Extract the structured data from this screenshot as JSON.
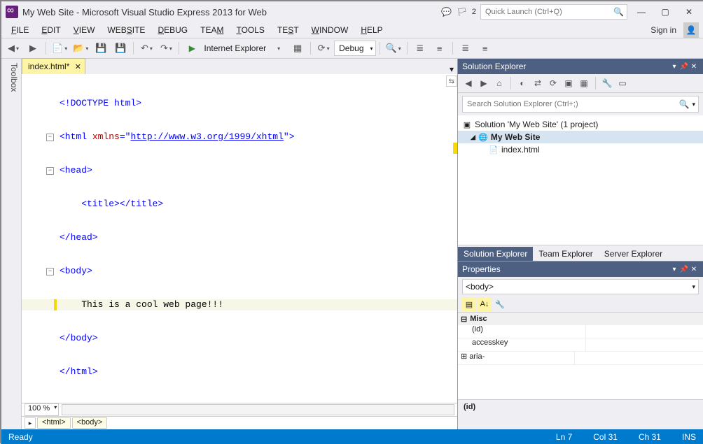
{
  "title": "My Web Site - Microsoft Visual Studio Express 2013 for Web",
  "notif_count": "2",
  "quicklaunch_placeholder": "Quick Launch (Ctrl+Q)",
  "menu": [
    "FILE",
    "EDIT",
    "VIEW",
    "WEBSITE",
    "DEBUG",
    "TEAM",
    "TOOLS",
    "TEST",
    "WINDOW",
    "HELP"
  ],
  "signin": "Sign in",
  "toolbar": {
    "run_target": "Internet Explorer",
    "config": "Debug"
  },
  "toolbox_label": "Toolbox",
  "tab": {
    "name": "index.html*"
  },
  "code": {
    "l1": "<!DOCTYPE html>",
    "l2a": "<html ",
    "l2b": "xmlns",
    "l2c": "=",
    "l2d": "\"",
    "l2e": "http://www.w3.org/1999/xhtml",
    "l2f": "\">",
    "l3": "<head>",
    "l4": "    <title></title>",
    "l5": "</head>",
    "l6": "<body>",
    "l7": "    This is a cool web page!!!",
    "l8": "</body>",
    "l9": "</html>"
  },
  "zoom": "100 %",
  "breadcrumb": [
    "<html>",
    "<body>"
  ],
  "se": {
    "title": "Solution Explorer",
    "search_placeholder": "Search Solution Explorer (Ctrl+;)",
    "sol": "Solution 'My Web Site' (1 project)",
    "proj": "My Web Site",
    "file": "index.html",
    "tabs": [
      "Solution Explorer",
      "Team Explorer",
      "Server Explorer"
    ]
  },
  "props": {
    "title": "Properties",
    "selector": "<body>",
    "cat": "Misc",
    "rows": [
      {
        "name": "(id)",
        "val": ""
      },
      {
        "name": "accesskey",
        "val": ""
      },
      {
        "name": "aria-",
        "val": ""
      }
    ],
    "desc": "(id)"
  },
  "status": {
    "ready": "Ready",
    "ln": "Ln 7",
    "col": "Col 31",
    "ch": "Ch 31",
    "ins": "INS"
  }
}
